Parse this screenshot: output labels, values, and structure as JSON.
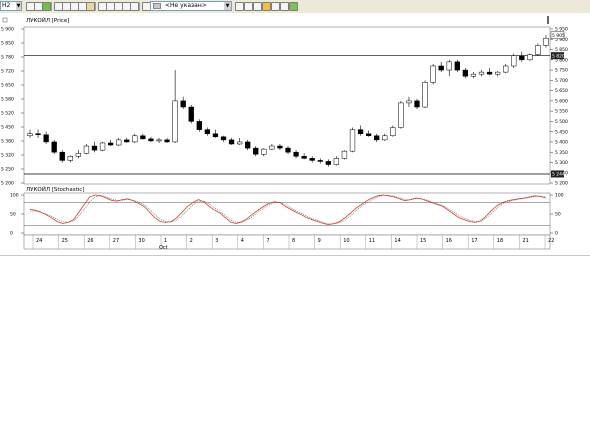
{
  "toolbar": {
    "timeframe": "H2",
    "items": [
      "new-chart-icon",
      "open-icon",
      "refresh-icon",
      "separator",
      "crosshair-icon",
      "zoom-in-icon",
      "zoom-out-icon",
      "percent-icon",
      "pan-icon",
      "separator",
      "line-tool-icon",
      "arrow-tool-icon",
      "pen-icon",
      "cursor-icon",
      "text-tool-icon",
      "separator",
      "candles-icon",
      "bars-icon"
    ],
    "status_value": "<Не указан>",
    "right_items": [
      "print-icon",
      "save-icon",
      "scales-icon",
      "color-icon",
      "settings-icon",
      "alert-icon",
      "export-icon"
    ]
  },
  "price_pane": {
    "title": "ЛУКОЙЛ [Price]",
    "right_ticks": [
      "5 950",
      "5 900",
      "5 850",
      "5 800",
      "5 750",
      "5 700",
      "5 650",
      "5 600",
      "5 550",
      "5 500",
      "5 450",
      "5 400",
      "5 350",
      "5 300",
      "5 250",
      "5 200"
    ],
    "left_ticks": [
      "5 900",
      "5 850",
      "5 780",
      "5 720",
      "5 650",
      "5 580",
      "5 520",
      "5 450",
      "5 380",
      "5 320",
      "5 250",
      "5 200"
    ],
    "upper_level_label": "5 820",
    "lower_level_label": "5 244",
    "last_price": "5 905"
  },
  "osc_pane": {
    "title": "ЛУКОЙЛ [Stochastic]",
    "ticks": [
      "100",
      "50",
      "0"
    ],
    "right_ticks": [
      "100",
      "50",
      "0"
    ]
  },
  "x_axis": {
    "dates": [
      "24",
      "25",
      "26",
      "27",
      "30",
      "1",
      "2",
      "3",
      "4",
      "7",
      "8",
      "9",
      "10",
      "11",
      "14",
      "15",
      "16",
      "17",
      "18",
      "21",
      "22"
    ],
    "month_label": "Oct"
  },
  "chart_data": {
    "type": "candlestick",
    "ylim": [
      5200,
      5950
    ],
    "up_color": "#ffffff",
    "down_color": "#000000",
    "candles": [
      [
        5430,
        5460,
        5420,
        5440
      ],
      [
        5440,
        5460,
        5420,
        5435
      ],
      [
        5435,
        5450,
        5390,
        5400
      ],
      [
        5400,
        5410,
        5340,
        5350
      ],
      [
        5350,
        5360,
        5300,
        5310
      ],
      [
        5310,
        5335,
        5300,
        5330
      ],
      [
        5330,
        5360,
        5320,
        5345
      ],
      [
        5345,
        5390,
        5340,
        5380
      ],
      [
        5380,
        5400,
        5350,
        5360
      ],
      [
        5360,
        5400,
        5355,
        5395
      ],
      [
        5395,
        5410,
        5380,
        5385
      ],
      [
        5385,
        5420,
        5380,
        5410
      ],
      [
        5410,
        5420,
        5395,
        5400
      ],
      [
        5400,
        5440,
        5395,
        5430
      ],
      [
        5430,
        5440,
        5410,
        5415
      ],
      [
        5415,
        5425,
        5400,
        5405
      ],
      [
        5405,
        5420,
        5395,
        5410
      ],
      [
        5410,
        5420,
        5395,
        5400
      ],
      [
        5400,
        5750,
        5395,
        5600
      ],
      [
        5600,
        5620,
        5560,
        5570
      ],
      [
        5570,
        5580,
        5490,
        5500
      ],
      [
        5500,
        5510,
        5450,
        5460
      ],
      [
        5460,
        5470,
        5430,
        5440
      ],
      [
        5440,
        5460,
        5420,
        5425
      ],
      [
        5425,
        5430,
        5400,
        5410
      ],
      [
        5410,
        5420,
        5385,
        5390
      ],
      [
        5390,
        5420,
        5385,
        5400
      ],
      [
        5400,
        5410,
        5360,
        5370
      ],
      [
        5370,
        5380,
        5330,
        5340
      ],
      [
        5340,
        5370,
        5330,
        5365
      ],
      [
        5365,
        5390,
        5360,
        5380
      ],
      [
        5380,
        5390,
        5360,
        5370
      ],
      [
        5370,
        5380,
        5340,
        5350
      ],
      [
        5350,
        5360,
        5320,
        5330
      ],
      [
        5330,
        5345,
        5315,
        5320
      ],
      [
        5320,
        5330,
        5300,
        5310
      ],
      [
        5310,
        5320,
        5295,
        5305
      ],
      [
        5305,
        5315,
        5280,
        5290
      ],
      [
        5290,
        5330,
        5285,
        5320
      ],
      [
        5320,
        5360,
        5315,
        5355
      ],
      [
        5355,
        5470,
        5350,
        5460
      ],
      [
        5460,
        5480,
        5430,
        5440
      ],
      [
        5440,
        5455,
        5425,
        5430
      ],
      [
        5430,
        5440,
        5400,
        5410
      ],
      [
        5410,
        5440,
        5405,
        5430
      ],
      [
        5430,
        5480,
        5425,
        5470
      ],
      [
        5470,
        5600,
        5465,
        5590
      ],
      [
        5590,
        5620,
        5570,
        5600
      ],
      [
        5600,
        5610,
        5560,
        5570
      ],
      [
        5570,
        5700,
        5565,
        5690
      ],
      [
        5690,
        5780,
        5680,
        5770
      ],
      [
        5770,
        5790,
        5740,
        5750
      ],
      [
        5750,
        5800,
        5720,
        5790
      ],
      [
        5790,
        5800,
        5740,
        5750
      ],
      [
        5750,
        5760,
        5710,
        5720
      ],
      [
        5720,
        5740,
        5710,
        5730
      ],
      [
        5730,
        5750,
        5720,
        5740
      ],
      [
        5740,
        5760,
        5725,
        5730
      ],
      [
        5730,
        5745,
        5720,
        5740
      ],
      [
        5740,
        5780,
        5735,
        5770
      ],
      [
        5770,
        5830,
        5760,
        5820
      ],
      [
        5820,
        5840,
        5790,
        5800
      ],
      [
        5800,
        5830,
        5795,
        5825
      ],
      [
        5825,
        5880,
        5820,
        5870
      ],
      [
        5870,
        5920,
        5860,
        5905
      ]
    ],
    "stochastic_k": [
      62,
      60,
      55,
      48,
      40,
      30,
      25,
      28,
      35,
      55,
      75,
      95,
      100,
      98,
      92,
      86,
      84,
      88,
      90,
      85,
      78,
      70,
      55,
      40,
      30,
      28,
      30,
      40,
      55,
      70,
      80,
      88,
      82,
      70,
      60,
      52,
      40,
      28,
      25,
      30,
      38,
      50,
      60,
      70,
      78,
      82,
      80,
      70,
      62,
      55,
      48,
      40,
      35,
      30,
      25,
      22,
      25,
      30,
      40,
      52,
      65,
      75,
      85,
      92,
      98,
      100,
      98,
      95,
      90,
      85,
      88,
      92,
      90,
      85,
      80,
      75,
      70,
      60,
      50,
      40,
      35,
      30,
      28,
      32,
      45,
      60,
      72,
      80,
      85,
      88,
      90,
      92,
      95,
      98,
      96,
      92
    ],
    "stochastic_d": [
      58,
      58,
      54,
      50,
      44,
      36,
      30,
      28,
      32,
      45,
      62,
      82,
      95,
      99,
      95,
      90,
      86,
      86,
      88,
      86,
      82,
      75,
      62,
      48,
      36,
      30,
      29,
      34,
      46,
      60,
      74,
      83,
      84,
      76,
      66,
      56,
      46,
      34,
      28,
      28,
      34,
      44,
      55,
      65,
      74,
      80,
      81,
      75,
      67,
      58,
      51,
      44,
      38,
      33,
      28,
      24,
      24,
      27,
      34,
      45,
      58,
      70,
      80,
      88,
      95,
      99,
      99,
      97,
      93,
      88,
      87,
      90,
      90,
      87,
      82,
      77,
      72,
      64,
      55,
      46,
      39,
      33,
      30,
      31,
      40,
      52,
      66,
      76,
      82,
      86,
      89,
      91,
      93,
      96,
      97,
      94
    ]
  }
}
